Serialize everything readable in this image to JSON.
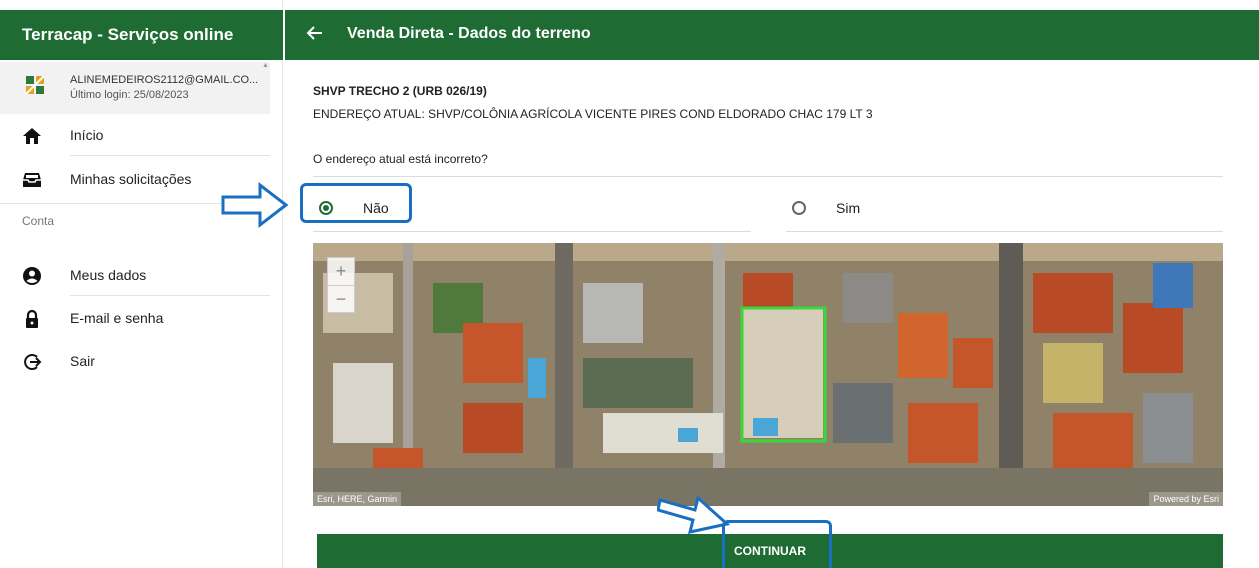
{
  "sidebar": {
    "header_title": "Terracap - Serviços online",
    "user": {
      "email": "ALINEMEDEIROS2112@GMAIL.CO...",
      "last_login": "Último login: 25/08/2023"
    },
    "items": [
      {
        "label": "Início",
        "icon": "home-icon"
      },
      {
        "label": "Minhas solicitações",
        "icon": "inbox-icon"
      }
    ],
    "section_label": "Conta",
    "account_items": [
      {
        "label": "Meus dados",
        "icon": "account-circle-icon"
      },
      {
        "label": "E-mail e senha",
        "icon": "lock-icon"
      },
      {
        "label": "Sair",
        "icon": "logout-icon"
      }
    ]
  },
  "header": {
    "title": "Venda Direta - Dados do terreno"
  },
  "main": {
    "lot_title": "SHVP TRECHO 2 (URB 026/19)",
    "lot_address": "ENDEREÇO ATUAL: SHVP/COLÔNIA AGRÍCOLA VICENTE PIRES COND ELDORADO CHAC 179 LT 3",
    "question": "O endereço atual está incorreto?",
    "options": [
      {
        "label": "Não",
        "selected": true
      },
      {
        "label": "Sim",
        "selected": false
      }
    ],
    "map": {
      "zoom_in": "+",
      "zoom_out": "−",
      "attribution": "Esri, HERE, Garmin",
      "powered_by": "Powered by Esri"
    },
    "continue_label": "CONTINUAR"
  },
  "colors": {
    "brand_green": "#1f6b34",
    "highlight_blue": "#1b6fc0",
    "lot_outline": "#39d83a"
  }
}
